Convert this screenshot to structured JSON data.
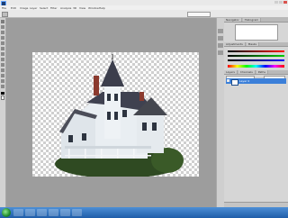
{
  "window": {
    "title": ""
  },
  "menus": [
    "File",
    "Edit",
    "Image",
    "Layer",
    "Select",
    "Filter",
    "Analysis",
    "3D",
    "View",
    "Window",
    "Help"
  ],
  "options_bar": {
    "zoom_text": ""
  },
  "panels": {
    "navigator_tabs": [
      "Navigator",
      "Histogram"
    ],
    "adjustments_tabs": [
      "Adjustments",
      "Masks"
    ],
    "layers_tabs": [
      "Layers",
      "Channels",
      "Paths"
    ],
    "layer_name": "Layer 0"
  },
  "taskbar": {
    "clock": ""
  },
  "colors": {
    "accent": "#3b7fd9",
    "canvas_bg": "#9d9d9d",
    "taskbar": "#2a6cb8"
  },
  "icons": [
    "photoshop-icon",
    "move-tool-icon",
    "marquee-tool-icon",
    "lasso-tool-icon",
    "brush-tool-icon",
    "start-button-icon"
  ]
}
